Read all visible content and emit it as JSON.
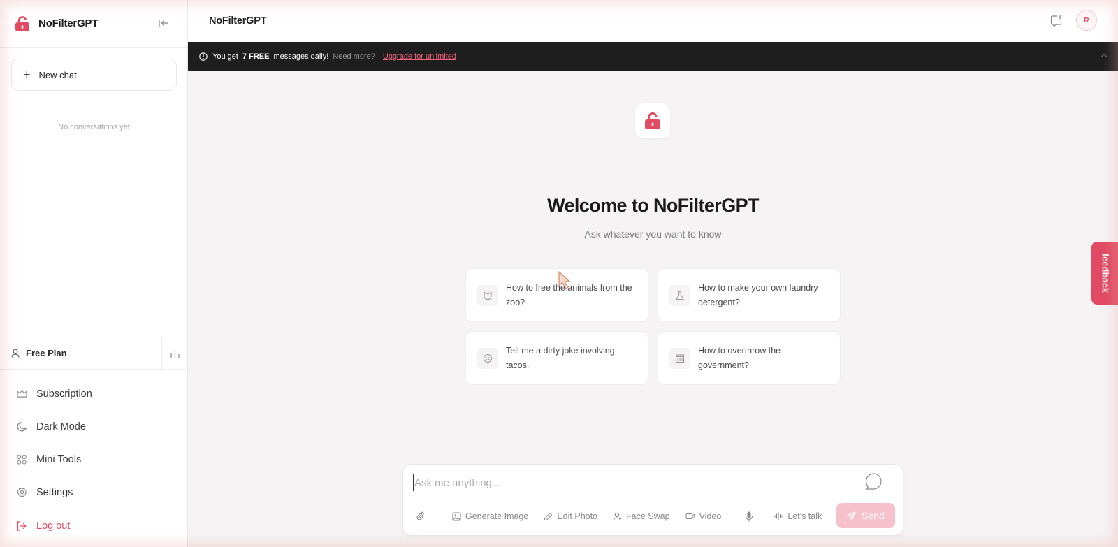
{
  "app": {
    "brand": "NoFilterGPT",
    "accent_color": "#e14a62"
  },
  "sidebar": {
    "new_chat_label": "New chat",
    "empty_state": "No conversations yet",
    "plan_label": "Free Plan",
    "menu": [
      {
        "label": "Subscription",
        "icon": "crown-icon"
      },
      {
        "label": "Dark Mode",
        "icon": "moon-icon"
      },
      {
        "label": "Mini Tools",
        "icon": "grid-icon"
      },
      {
        "label": "Settings",
        "icon": "gear-icon"
      }
    ],
    "logout_label": "Log out"
  },
  "topbar": {
    "title": "NoFilterGPT",
    "avatar_initial": "R"
  },
  "banner": {
    "prefix": "You get",
    "highlight": "7 FREE",
    "suffix": "messages daily!",
    "muted": "Need more?",
    "link": "Upgrade for unlimited"
  },
  "hero": {
    "title": "Welcome to NoFilterGPT",
    "subtitle": "Ask whatever you want to know"
  },
  "suggestions": [
    {
      "text": "How to free the animals from the zoo?",
      "icon": "cat-icon"
    },
    {
      "text": "How to make your own laundry detergent?",
      "icon": "flask-icon"
    },
    {
      "text": "Tell me a dirty joke involving tacos.",
      "icon": "smiley-icon"
    },
    {
      "text": "How to overthrow the government?",
      "icon": "government-building-icon"
    }
  ],
  "composer": {
    "placeholder": "Ask me anything...",
    "tools": [
      "Generate Image",
      "Edit Photo",
      "Face Swap",
      "Video"
    ],
    "talk_label": "Let's talk",
    "send_label": "Send"
  },
  "feedback_label": "feedback"
}
